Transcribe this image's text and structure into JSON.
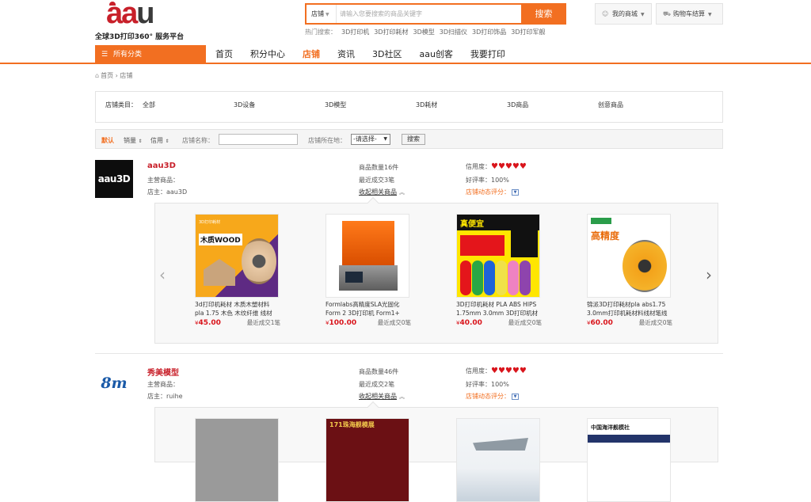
{
  "header": {
    "logo_text_a": "aa",
    "logo_text_u": "u",
    "tagline": "全球3D打印360° 服务平台",
    "search": {
      "category": "店铺",
      "placeholder": "请输入您要搜索的商品关键字",
      "button": "搜索"
    },
    "hot_label": "热门搜索：",
    "hot_keywords": [
      "3D打印机",
      "3D打印耗材",
      "3D模型",
      "3D扫描仪",
      "3D打印饰品",
      "3D打印军舰"
    ],
    "my_mall": "我的商城",
    "cart": "购物车结算"
  },
  "nav": {
    "all_categories": "所有分类",
    "links": [
      "首页",
      "积分中心",
      "店铺",
      "资讯",
      "3D社区",
      "aau创客",
      "我要打印"
    ],
    "active_index": 2
  },
  "breadcrumb": {
    "home": "首页",
    "sep": "›",
    "current": "店铺"
  },
  "store_categories": {
    "label": "店铺类目：",
    "items": [
      "全部",
      "3D设备",
      "3D模型",
      "3D耗材",
      "3D商品",
      "创意商品"
    ]
  },
  "sort_bar": {
    "default": "默认",
    "sales": "销量",
    "credit": "信用",
    "arrow": "⇕",
    "name_label": "店铺名称：",
    "location_label": "店铺所在地：",
    "location_value": "-请选择-",
    "search_button": "搜索"
  },
  "stores": [
    {
      "name": "aau3D",
      "logo_text": "aau3D",
      "main_products_label": "主营商品：",
      "owner_label": "店主：",
      "owner": "aau3D",
      "product_count": "商品数量16件",
      "recent_deals": "最近成交3笔",
      "toggle": "收起相关商品",
      "credit_label": "信用度：",
      "hearts": "♥♥♥♥♥",
      "good_rate": "好评率：100%",
      "dynamic_score": "店铺动态评分：",
      "products": [
        {
          "title": "3d打印机耗材 木质木塑材料 pla 1.75 木色 木纹纤维 线材",
          "price": "45.00",
          "sold": "最近成交1笔",
          "img_text_1": "3D打印耗材",
          "img_text_2": "木质WOOD"
        },
        {
          "title": "Formlabs高精度SLA光固化 Form 2 3D打印机 Form1+",
          "price": "100.00",
          "sold": "最近成交0笔"
        },
        {
          "title": "3D打印机耗材 PLA ABS HIPS 1.75mm 3.0mm 3D打印机材",
          "price": "40.00",
          "sold": "最近成交0笔",
          "img_text_1": "真便宜"
        },
        {
          "title": "锦派3D打印耗材pla abs1.75 3.0mm打印机耗材料线材笔线",
          "price": "60.00",
          "sold": "最近成交0笔",
          "img_text_1": "高精度"
        }
      ]
    },
    {
      "name": "秀美模型",
      "logo_text": "8m",
      "main_products_label": "主营商品：",
      "owner_label": "店主：",
      "owner": "ruihe",
      "product_count": "商品数量46件",
      "recent_deals": "最近成交2笔",
      "toggle": "收起相关商品",
      "credit_label": "信用度：",
      "hearts": "♥♥♥♥♥",
      "good_rate": "好评率：100%",
      "dynamic_score": "店铺动态评分：",
      "products": [
        {},
        {
          "img_text_1": "171珠海舰模展"
        },
        {},
        {
          "img_text_1": "中国海洋舰模社"
        }
      ]
    }
  ],
  "currency": "¥",
  "colors": {
    "accent": "#f26f21",
    "price": "#d9141b",
    "store_name": "#c8202a"
  }
}
